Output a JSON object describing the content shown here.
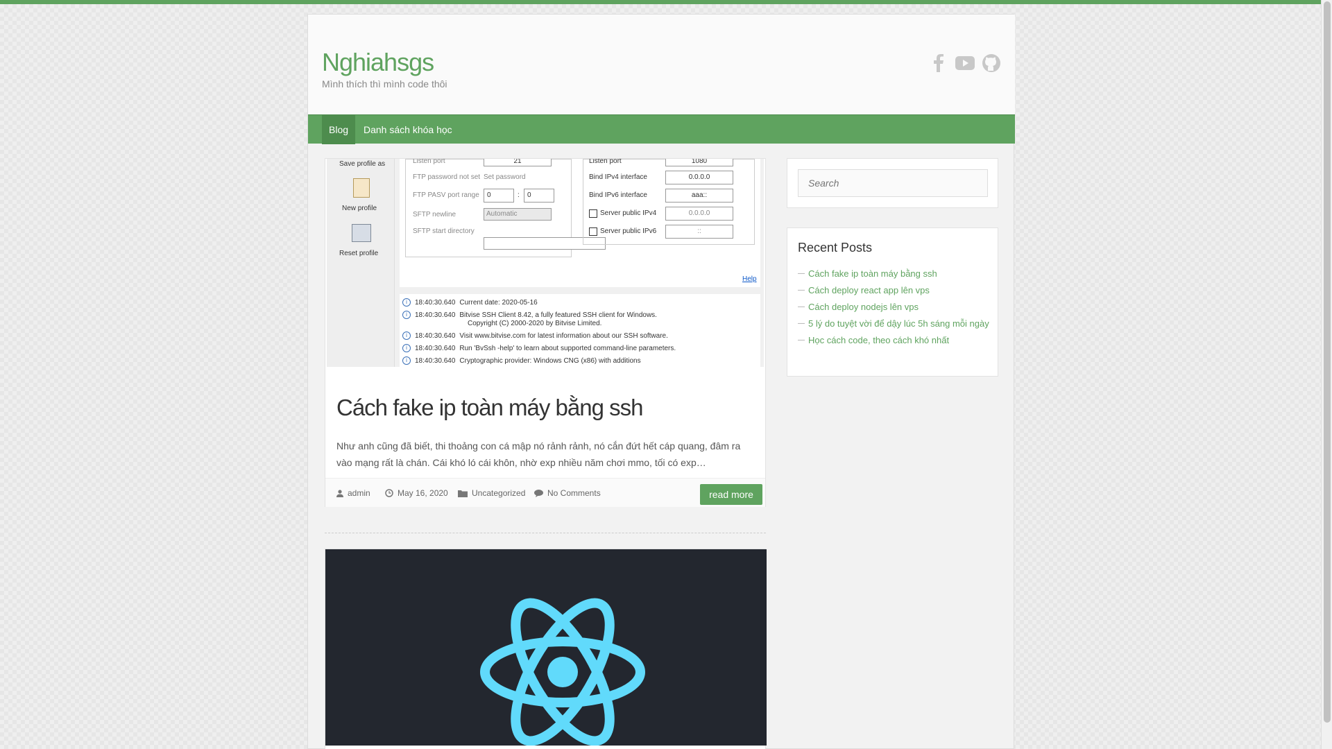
{
  "site": {
    "title": "Nghiahsgs",
    "description": "Mình thích thì mình code thôi",
    "social": [
      "facebook-icon",
      "youtube-icon",
      "github-icon"
    ]
  },
  "nav": {
    "items": [
      {
        "label": "Blog",
        "active": true
      },
      {
        "label": "Danh sách khóa học",
        "active": false
      }
    ]
  },
  "post1": {
    "title": "Cách fake ip toàn máy bằng ssh",
    "excerpt": "Như anh cũng đã biết, thi thoảng con cá mập nó rảnh rảnh, nó cắn đứt hết cáp quang, đâm ra vào mạng rất là chán. Cái khó ló cái khôn, nhờ exp nhiều năm chơi mmo, tối có exp…",
    "meta": {
      "author": "admin",
      "date": "May 16, 2020",
      "category": "Uncategorized",
      "comments": "No Comments"
    },
    "read_more": "read more",
    "screenshot": {
      "left_items": [
        "Save profile as",
        "New profile",
        "Reset profile"
      ],
      "ftp_labels": [
        "Listen port",
        "FTP password not set",
        "FTP PASV port range",
        "SFTP newline",
        "SFTP start directory"
      ],
      "ftp_values": {
        "listen": "21",
        "set_password": "Set password",
        "pasv_from": "0",
        "pasv_sep": ":",
        "pasv_to": "0",
        "newline": "Automatic"
      },
      "bind_labels": [
        "Listen port",
        "Bind IPv4 interface",
        "Bind IPv6 interface",
        "Server public IPv4",
        "Server public IPv6"
      ],
      "bind_values": [
        "1080",
        "0.0.0.0",
        "aaa::",
        "0.0.0.0",
        "::"
      ],
      "help": "Help",
      "log": [
        {
          "time": "18:40:30.640",
          "text": "Current date: 2020-05-16"
        },
        {
          "time": "18:40:30.640",
          "text": "Bitvise SSH Client 8.42, a fully featured SSH client for Windows."
        },
        {
          "time": "",
          "text": "Copyright (C) 2000-2020 by Bitvise Limited."
        },
        {
          "time": "18:40:30.640",
          "text": "Visit www.bitvise.com for latest information about our SSH software."
        },
        {
          "time": "18:40:30.640",
          "text": "Run 'BvSsh -help' to learn about supported command-line parameters."
        },
        {
          "time": "18:40:30.640",
          "text": "Cryptographic provider: Windows CNG (x86) with additions"
        }
      ]
    }
  },
  "post2": {
    "image": "react-logo"
  },
  "sidebar": {
    "search_placeholder": "Search",
    "recent_title": "Recent Posts",
    "recent_posts": [
      "Cách fake ip toàn máy bằng ssh",
      "Cách deploy react app lên vps",
      "Cách deploy nodejs lên vps",
      "5 lý do tuyệt vời để dậy lúc 5h sáng mỗi ngày",
      "Học cách code, theo cách khó nhất"
    ]
  },
  "colors": {
    "accent": "#5fa35f",
    "react": "#61dafb",
    "react_bg": "#23272f"
  }
}
